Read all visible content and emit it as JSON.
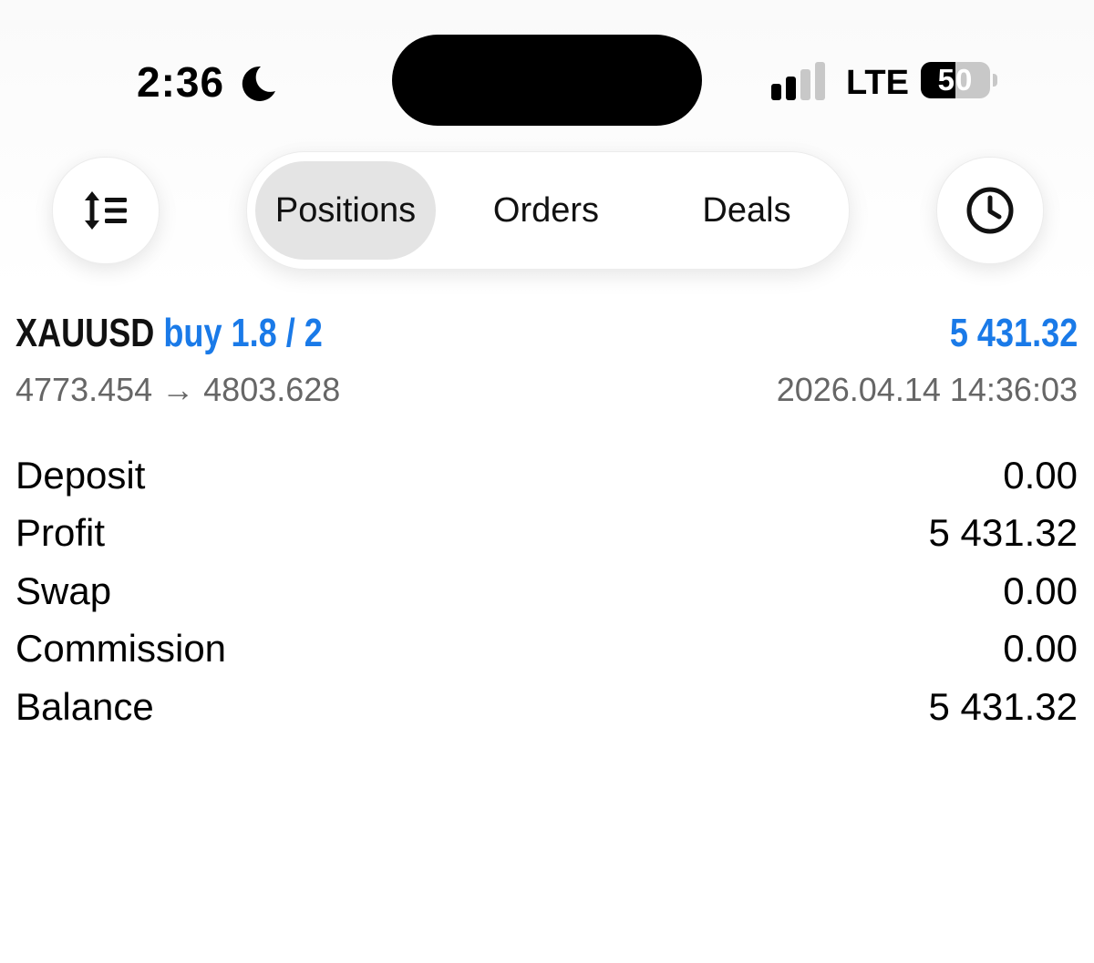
{
  "status_bar": {
    "time": "2:36",
    "network": "LTE",
    "battery_level": "50",
    "battery_fraction": 0.5,
    "focus_icon": "moon-icon",
    "signal_bars_active": 2,
    "signal_bars_total": 4
  },
  "toolbar": {
    "sort_icon": "sort-icon",
    "history_icon": "clock-icon",
    "tabs": [
      {
        "label": "Positions",
        "active": true
      },
      {
        "label": "Orders",
        "active": false
      },
      {
        "label": "Deals",
        "active": false
      }
    ]
  },
  "deal": {
    "symbol": "XAUUSD",
    "direction": "buy 1.8 / 2",
    "profit": "5 431.32",
    "prices": "4773.454 → 4803.628",
    "time": "2026.04.14 14:36:03",
    "accent_color": "#1a7ae8"
  },
  "details": [
    {
      "label": "Deposit",
      "value": "0.00"
    },
    {
      "label": "Profit",
      "value": "5 431.32"
    },
    {
      "label": "Swap",
      "value": "0.00"
    },
    {
      "label": "Commission",
      "value": "0.00"
    },
    {
      "label": "Balance",
      "value": "5 431.32"
    }
  ]
}
